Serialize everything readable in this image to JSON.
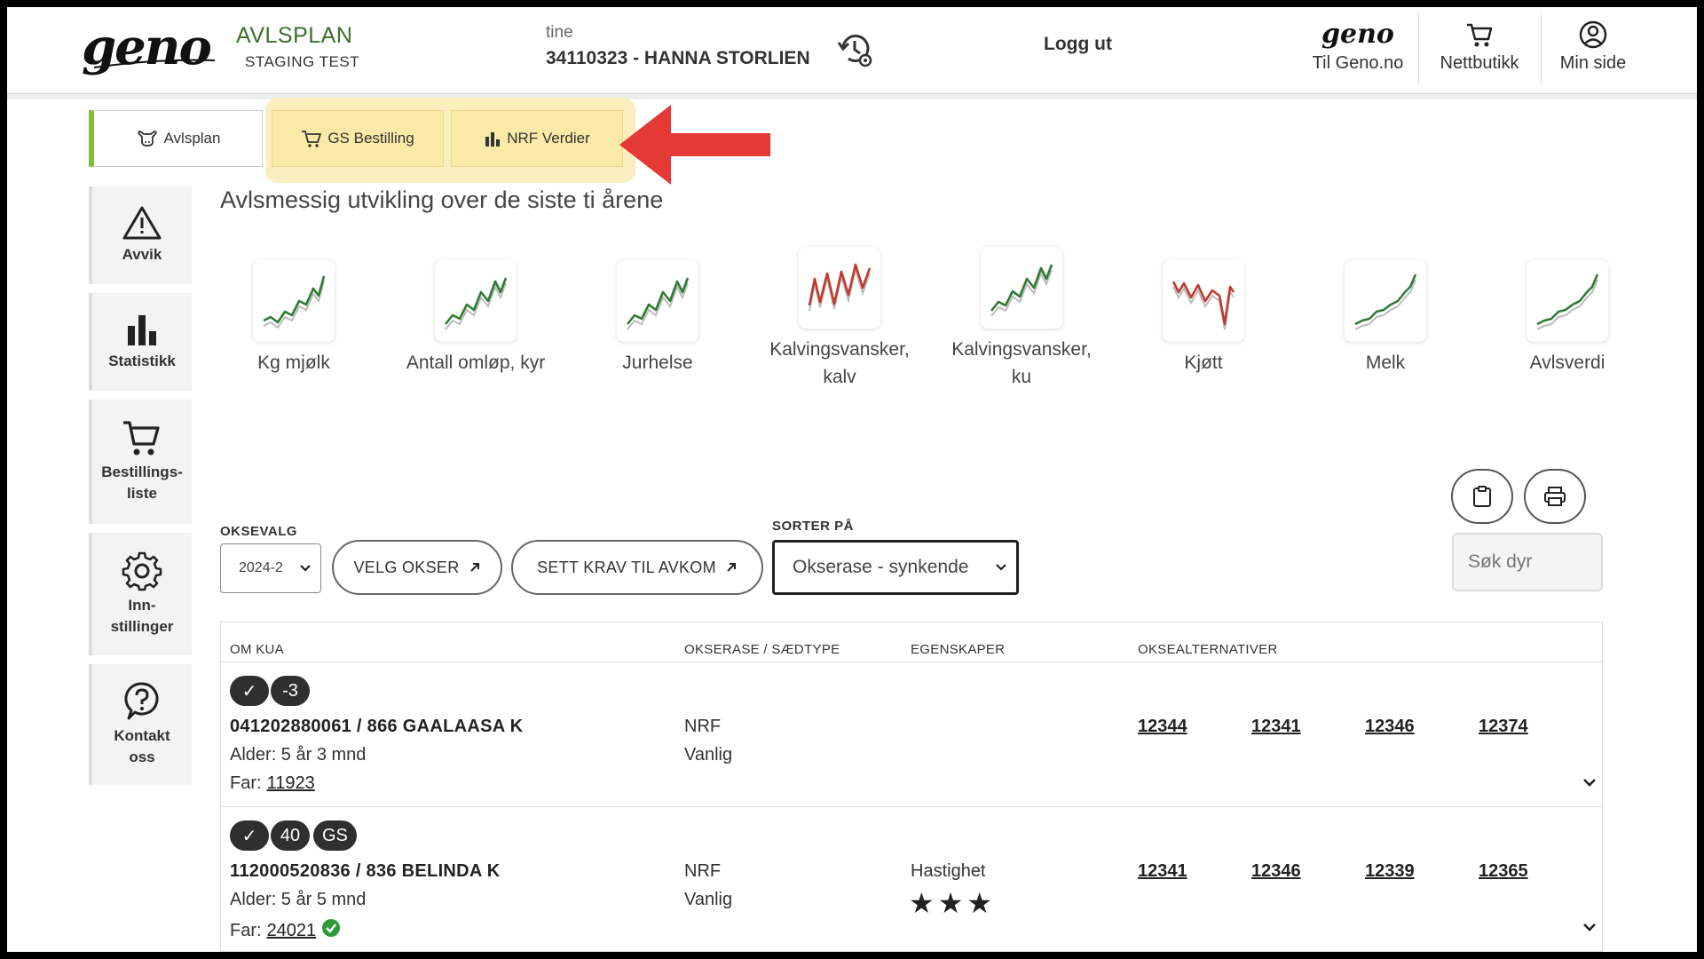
{
  "header": {
    "logo_text": "geno",
    "app_title": "AVLSPLAN",
    "app_subtitle": "STAGING TEST",
    "farm_label": "tine",
    "farm_name": "34110323 - HANNA STORLIEN",
    "logout_label": "Logg ut",
    "links": [
      {
        "label": "Til Geno.no",
        "icon": "geno-logo"
      },
      {
        "label": "Nettbutikk",
        "icon": "cart-icon"
      },
      {
        "label": "Min side",
        "icon": "user-icon"
      }
    ],
    "small_logo_text": "geno"
  },
  "tabs": [
    {
      "label": "Avlsplan",
      "icon": "cow-icon",
      "active": true
    },
    {
      "label": "GS Bestilling",
      "icon": "cart-icon",
      "active": false
    },
    {
      "label": "NRF Verdier",
      "icon": "bar-chart-icon",
      "active": false
    }
  ],
  "sidebar": [
    {
      "label": "Avvik",
      "icon": "warning-icon"
    },
    {
      "label": "Statistikk",
      "icon": "bar-chart-icon"
    },
    {
      "label": "Bestillings-\nliste",
      "line1": "Bestillings-",
      "line2": "liste",
      "icon": "cart-icon"
    },
    {
      "line1": "Inn-",
      "line2": "stillinger",
      "icon": "gear-icon"
    },
    {
      "line1": "Kontakt",
      "line2": "oss",
      "icon": "question-icon"
    }
  ],
  "section_title": "Avlsmessig utvikling over de siste ti årene",
  "trends": [
    {
      "line1": "Kg mjølk",
      "line2": "",
      "color": "#2e7d32"
    },
    {
      "line1": "Antall omløp, kyr",
      "line2": "",
      "color": "#2e7d32"
    },
    {
      "line1": "Jurhelse",
      "line2": "",
      "color": "#2e7d32"
    },
    {
      "line1": "Kalvingsvansker,",
      "line2": "kalv",
      "color": "#c0392b"
    },
    {
      "line1": "Kalvingsvansker,",
      "line2": "ku",
      "color": "#2e7d32"
    },
    {
      "line1": "Kjøtt",
      "line2": "",
      "color": "#c0392b"
    },
    {
      "line1": "Melk",
      "line2": "",
      "color": "#2e7d32"
    },
    {
      "line1": "Avlsverdi",
      "line2": "",
      "color": "#2e7d32"
    }
  ],
  "controls": {
    "oksevalg_label": "OKSEVALG",
    "oksevalg_value": "2024-2",
    "velg_okser_label": "VELG OKSER",
    "sett_krav_label": "SETT KRAV TIL AVKOM",
    "sorter_label": "SORTER PÅ",
    "sorter_value": "Okserase - synkende",
    "search_placeholder": "Søk dyr"
  },
  "table": {
    "headers": [
      "OM KUA",
      "OKSERASE / SÆDTYPE",
      "EGENSKAPER",
      "OKSEALTERNATIVER"
    ],
    "rows": [
      {
        "badges": [
          "✓",
          "-3"
        ],
        "cow": "041202880061 / 866 GAALAASA K",
        "age": "Alder: 5 år 3 mnd",
        "far_label": "Far:",
        "far": "11923",
        "far_verified": false,
        "race": "NRF",
        "semen": "Vanlig",
        "trait": "",
        "stars": "",
        "bulls": [
          "12344",
          "12341",
          "12346",
          "12374"
        ]
      },
      {
        "badges": [
          "✓",
          "40",
          "GS"
        ],
        "cow": "112000520836 / 836 BELINDA K",
        "age": "Alder: 5 år 5 mnd",
        "far_label": "Far:",
        "far": "24021",
        "far_verified": true,
        "race": "NRF",
        "semen": "Vanlig",
        "trait": "Hastighet",
        "stars": "★★★",
        "bulls": [
          "12341",
          "12346",
          "12339",
          "12365"
        ]
      }
    ]
  },
  "colors": {
    "brand_green": "#3b6f2a",
    "tab_active_accent": "#7fbf3a",
    "highlight_yellow": "#fbefc0",
    "arrow_red": "#e53935",
    "trend_green": "#2e7d32",
    "trend_red": "#c0392b"
  }
}
